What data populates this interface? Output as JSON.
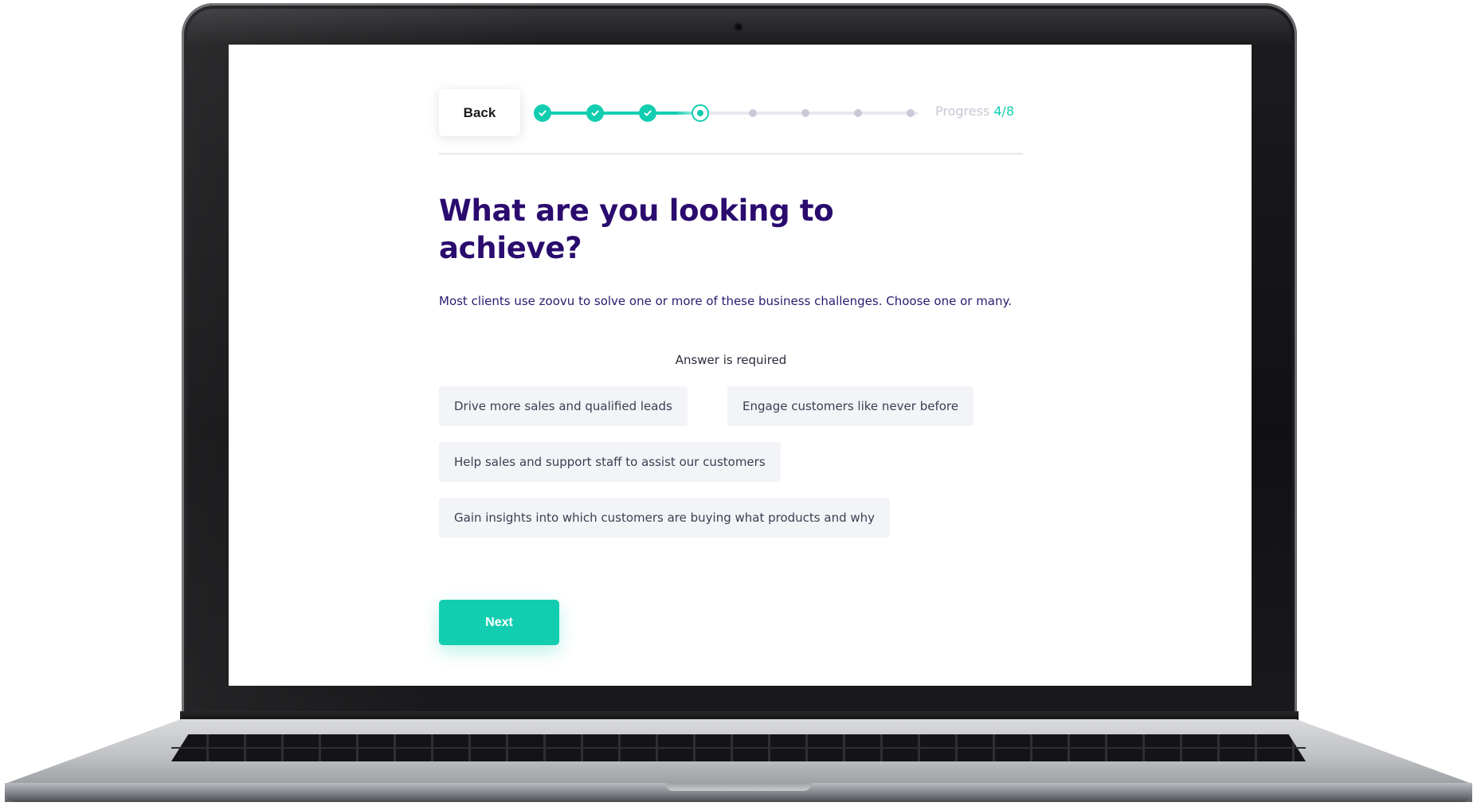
{
  "wizard": {
    "back_label": "Back",
    "progress": {
      "label": "Progress",
      "count_text": "4/8",
      "current_step": 4,
      "total_steps": 8
    },
    "question": "What are you looking to achieve?",
    "subtitle": "Most clients use zoovu to solve one or more of these business challenges. Choose one or many.",
    "required_text": "Answer is required",
    "options": [
      "Drive more sales and qualified leads",
      "Engage customers like never before",
      "Help sales and support staff to assist our customers",
      "Gain insights into which customers are buying what products and why"
    ],
    "next_label": "Next"
  },
  "colors": {
    "accent": "#13cdb0",
    "heading": "#2a0b6e",
    "option_bg": "#f3f4f7",
    "pending_dot": "#c9cad8"
  }
}
